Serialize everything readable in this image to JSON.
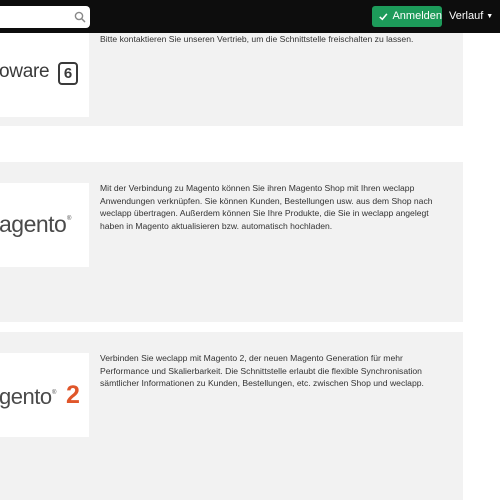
{
  "header": {
    "search": {
      "value": "",
      "placeholder": ""
    },
    "login_label": "Anmelden",
    "history_label": "Verlauf",
    "colors": {
      "bar": "#0d0d0d",
      "login": "#1d9b5a"
    }
  },
  "cards": [
    {
      "logo_text": "oware",
      "logo_badge": "6",
      "text": "Bitte kontaktieren Sie unseren Vertrieb, um die Schnittstelle freischalten zu lassen."
    },
    {
      "logo_text": "agento",
      "logo_reg": "®",
      "text": "Mit der Verbindung zu Magento können Sie ihren Magento Shop mit Ihren weclapp Anwendungen verknüpfen. Sie können Kunden, Bestellungen usw. aus dem Shop nach weclapp übertragen. Außerdem können Sie Ihre Produkte, die Sie in weclapp angelegt haben in Magento aktualisieren bzw. automatisch hochladen."
    },
    {
      "logo_text": "gento",
      "logo_reg": "®",
      "logo_badge": "2",
      "text": "Verbinden Sie weclapp mit Magento 2, der neuen Magento Generation für mehr Performance und Skalierbarkeit. Die Schnittstelle erlaubt die flexible Synchronisation sämtlicher Informationen zu Kunden, Bestellungen, etc. zwischen Shop und weclapp."
    }
  ]
}
